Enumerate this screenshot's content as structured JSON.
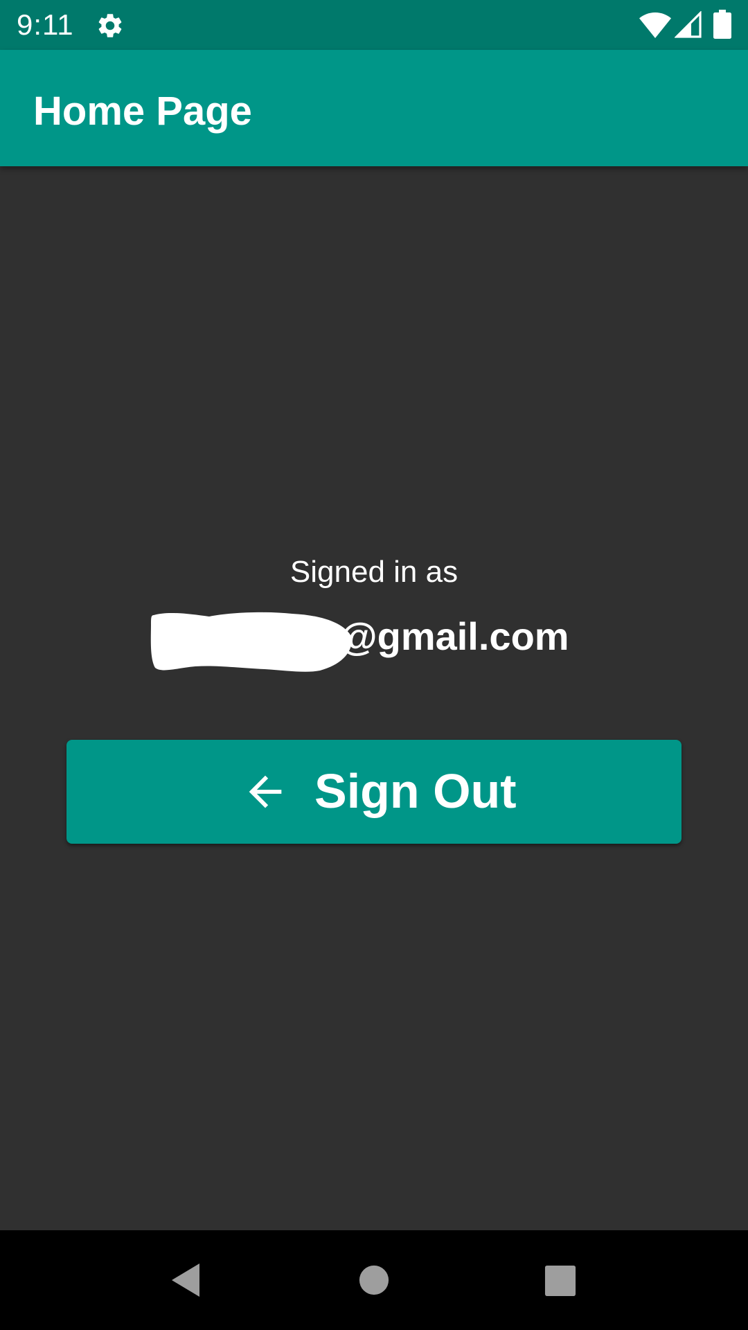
{
  "status_bar": {
    "time": "9:11",
    "icons": [
      "gear-icon",
      "wifi-icon",
      "cell-signal-icon",
      "battery-icon"
    ]
  },
  "app_bar": {
    "title": "Home Page"
  },
  "main": {
    "signed_in_label": "Signed in as",
    "email_suffix": "@gmail.com",
    "sign_out_label": "Sign Out",
    "sign_out_icon": "arrow-back-icon"
  },
  "nav_bar": {
    "icons": [
      "back-icon",
      "home-icon",
      "recents-icon"
    ]
  },
  "colors": {
    "status_bar": "#00796B",
    "app_bar": "#009688",
    "background": "#303030",
    "nav_bar": "#000000",
    "button": "#009688",
    "text": "#FFFFFF"
  }
}
